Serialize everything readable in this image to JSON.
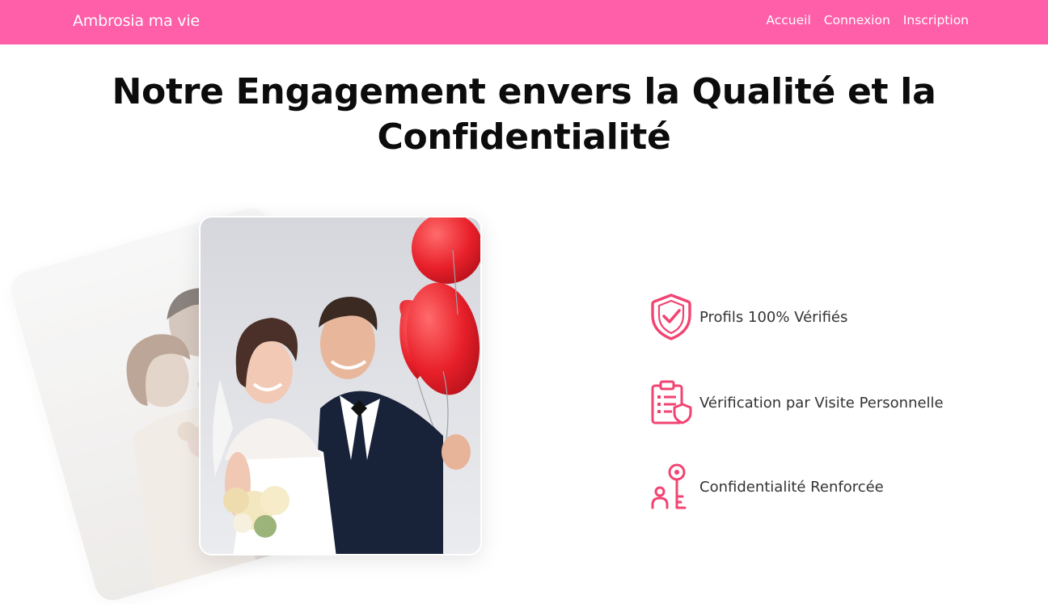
{
  "colors": {
    "brand": "#ff5ea8",
    "icon_accent": "#f24472"
  },
  "navbar": {
    "brand": "Ambrosia ma vie",
    "links": [
      "Accueil",
      "Connexion",
      "Inscription"
    ]
  },
  "hero": {
    "title": "Notre Engagement envers la Qualité et la Confidentialité"
  },
  "features": [
    {
      "icon": "shield-check-icon",
      "label": "Profils 100% Vérifiés"
    },
    {
      "icon": "clipboard-shield-icon",
      "label": "Vérification par Visite Personnelle"
    },
    {
      "icon": "key-person-icon",
      "label": "Confidentialité Renforcée"
    }
  ]
}
